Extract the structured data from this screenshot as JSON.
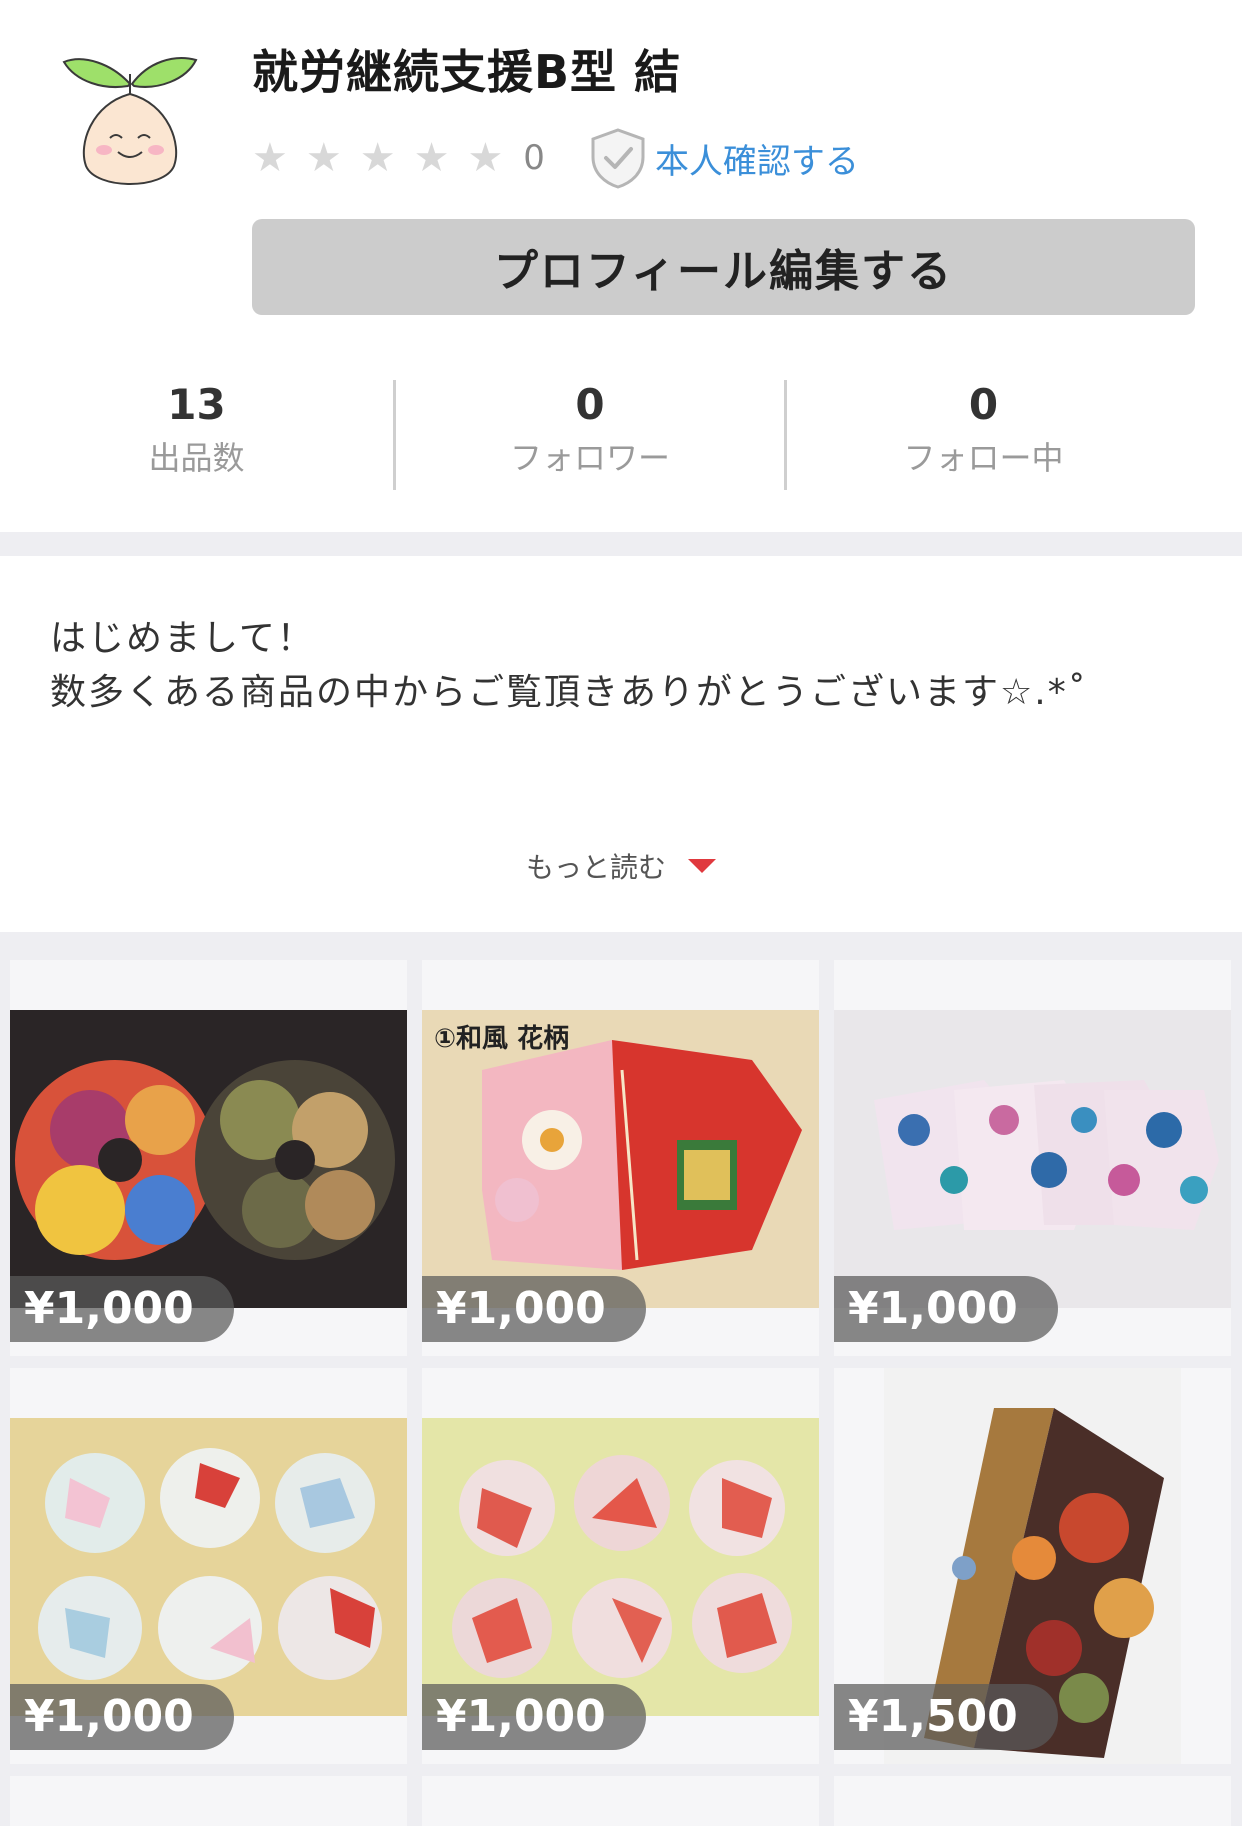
{
  "profile": {
    "shop_name": "就労継続支援B型 結",
    "rating": 0,
    "rating_count": "0",
    "verify_label": "本人確認する",
    "edit_button_label": "プロフィール編集する"
  },
  "stats": [
    {
      "value": "13",
      "label": "出品数"
    },
    {
      "value": "0",
      "label": "フォロワー"
    },
    {
      "value": "0",
      "label": "フォロー中"
    }
  ],
  "bio": {
    "line1": "はじめまして！",
    "line2": "数多くある商品の中からご覧頂きありがとうございます☆.*˚",
    "read_more_label": "もっと読む"
  },
  "items": [
    {
      "price": "¥1,000",
      "image": "kimono-scrunchies"
    },
    {
      "price": "¥1,000",
      "image": "japanese-floral-mask",
      "photo_caption": "①和風 花柄"
    },
    {
      "price": "¥1,000",
      "image": "blue-floral-masks"
    },
    {
      "price": "¥1,000",
      "image": "fabric-buttons-pastel"
    },
    {
      "price": "¥1,000",
      "image": "fabric-buttons-red"
    },
    {
      "price": "¥1,500",
      "image": "book-shaped-storage-box"
    }
  ],
  "colors": {
    "verify_link": "#3b8fd9",
    "read_more_arrow": "#e0393e",
    "button_bg": "#cccccc"
  }
}
